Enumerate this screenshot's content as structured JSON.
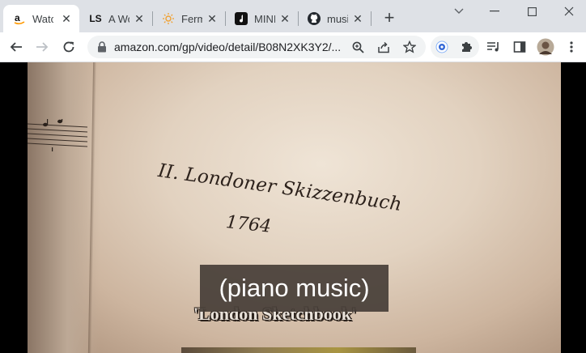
{
  "tabs": [
    {
      "label": "Watc",
      "favicon": "amazon-icon",
      "active": true
    },
    {
      "label": "A Wo",
      "favicon": "LS",
      "active": false
    },
    {
      "label": "Ferm",
      "favicon": "sun-icon",
      "active": false
    },
    {
      "label": "MINI",
      "favicon": "music-note-icon",
      "active": false
    },
    {
      "label": "musi",
      "favicon": "github-icon",
      "active": false
    }
  ],
  "close_glyph": "✕",
  "new_tab_glyph": "+",
  "window_controls": {
    "chevron": "⌄",
    "minimize": "—",
    "maximize": "☐",
    "close": "✕"
  },
  "address_bar": {
    "url": "amazon.com/gp/video/detail/B08N2XK3Y2/..."
  },
  "video": {
    "book_title": "II. Londoner Skizzenbuch",
    "book_year": "1764",
    "caption": "(piano music)",
    "burned_subtitle": "'London Sketchbook'"
  },
  "colors": {
    "chrome_bg": "#dee1e6",
    "toolbar_bg": "#ffffff",
    "caption_bg": "#463e37"
  }
}
